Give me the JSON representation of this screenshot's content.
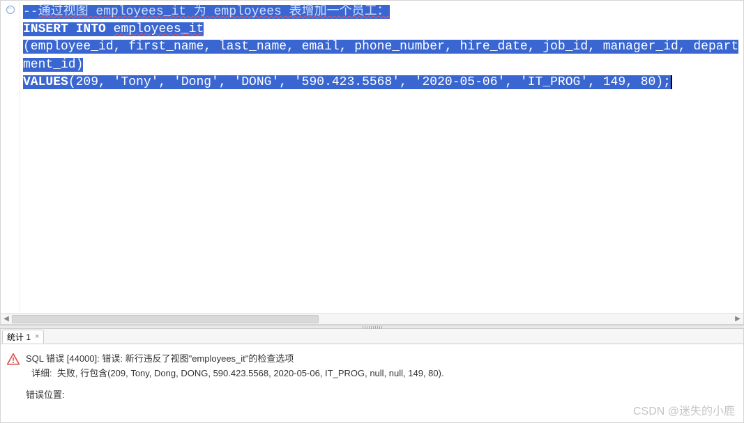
{
  "editor": {
    "fold_tooltip": "toggle fold",
    "code": {
      "comment_prefix": "--",
      "comment_text": "通过视图 employees_it 为 employees 表增加一个员工：",
      "kw_insert": "INSERT INTO",
      "tbl": "employees_it",
      "cols": "(employee_id, first_name, last_name, email, phone_number, hire_date, job_id, manager_id, department_id)",
      "kw_values": "VALUES",
      "vals": "(209, 'Tony', 'Dong', 'DONG', '590.423.5568', '2020-05-06', 'IT_PROG', 149, 80);"
    }
  },
  "tab": {
    "label": "统计 1",
    "close": "×"
  },
  "error": {
    "line1": "SQL 错误 [44000]: 错误: 新行违反了视图\"employees_it\"的检查选项",
    "line2_label": "详细:",
    "line2_text": "失败, 行包含(209, Tony, Dong, DONG, 590.423.5568, 2020-05-06, IT_PROG, null, null, 149, 80).",
    "line3": "错误位置:"
  },
  "scroll": {
    "left": "◀",
    "right": "▶"
  },
  "watermark": "CSDN @迷失的小鹿"
}
